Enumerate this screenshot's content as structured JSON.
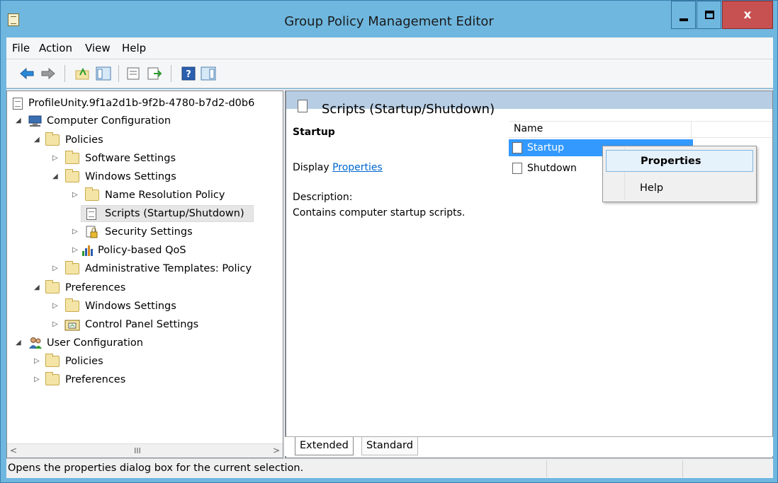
{
  "window": {
    "title": "Group Policy Management Editor"
  },
  "menu": [
    "File",
    "Action",
    "View",
    "Help"
  ],
  "toolbar": {
    "icons": [
      "back-arrow-icon",
      "forward-arrow-icon",
      "up-folder-icon",
      "show-hide-tree-icon",
      "properties-icon",
      "export-list-icon",
      "help-icon",
      "show-action-pane-icon"
    ]
  },
  "tree": {
    "root": "ProfileUnity.9f1a2d1b-9f2b-4780-b7d2-d0b6",
    "items": [
      {
        "label": "Computer Configuration"
      },
      {
        "label": "Policies"
      },
      {
        "label": "Software Settings"
      },
      {
        "label": "Windows Settings"
      },
      {
        "label": "Name Resolution Policy"
      },
      {
        "label": "Scripts (Startup/Shutdown)"
      },
      {
        "label": "Security Settings"
      },
      {
        "label": "Policy-based QoS"
      },
      {
        "label": "Administrative Templates: Policy"
      },
      {
        "label": "Preferences"
      },
      {
        "label": "Windows Settings"
      },
      {
        "label": "Control Panel Settings"
      },
      {
        "label": "User Configuration"
      },
      {
        "label": "Policies"
      },
      {
        "label": "Preferences"
      }
    ]
  },
  "details": {
    "header_title": "Scripts (Startup/Shutdown)",
    "section_title": "Startup",
    "display_prefix": "Display",
    "display_link": "Properties",
    "description_label": "Description:",
    "description_text": "Contains computer startup scripts."
  },
  "list": {
    "column_name": "Name",
    "rows": [
      "Startup",
      "Shutdown"
    ]
  },
  "context_menu": {
    "items": [
      "Properties",
      "Help"
    ]
  },
  "tabs": [
    "Extended",
    "Standard"
  ],
  "status": {
    "text": "Opens the properties dialog box for the current selection."
  },
  "colors": {
    "titlebar": "#6fb7df",
    "selection": "#3399ff",
    "link": "#0066cc",
    "header_band": "#b7cde3",
    "close_button": "#c75050"
  }
}
